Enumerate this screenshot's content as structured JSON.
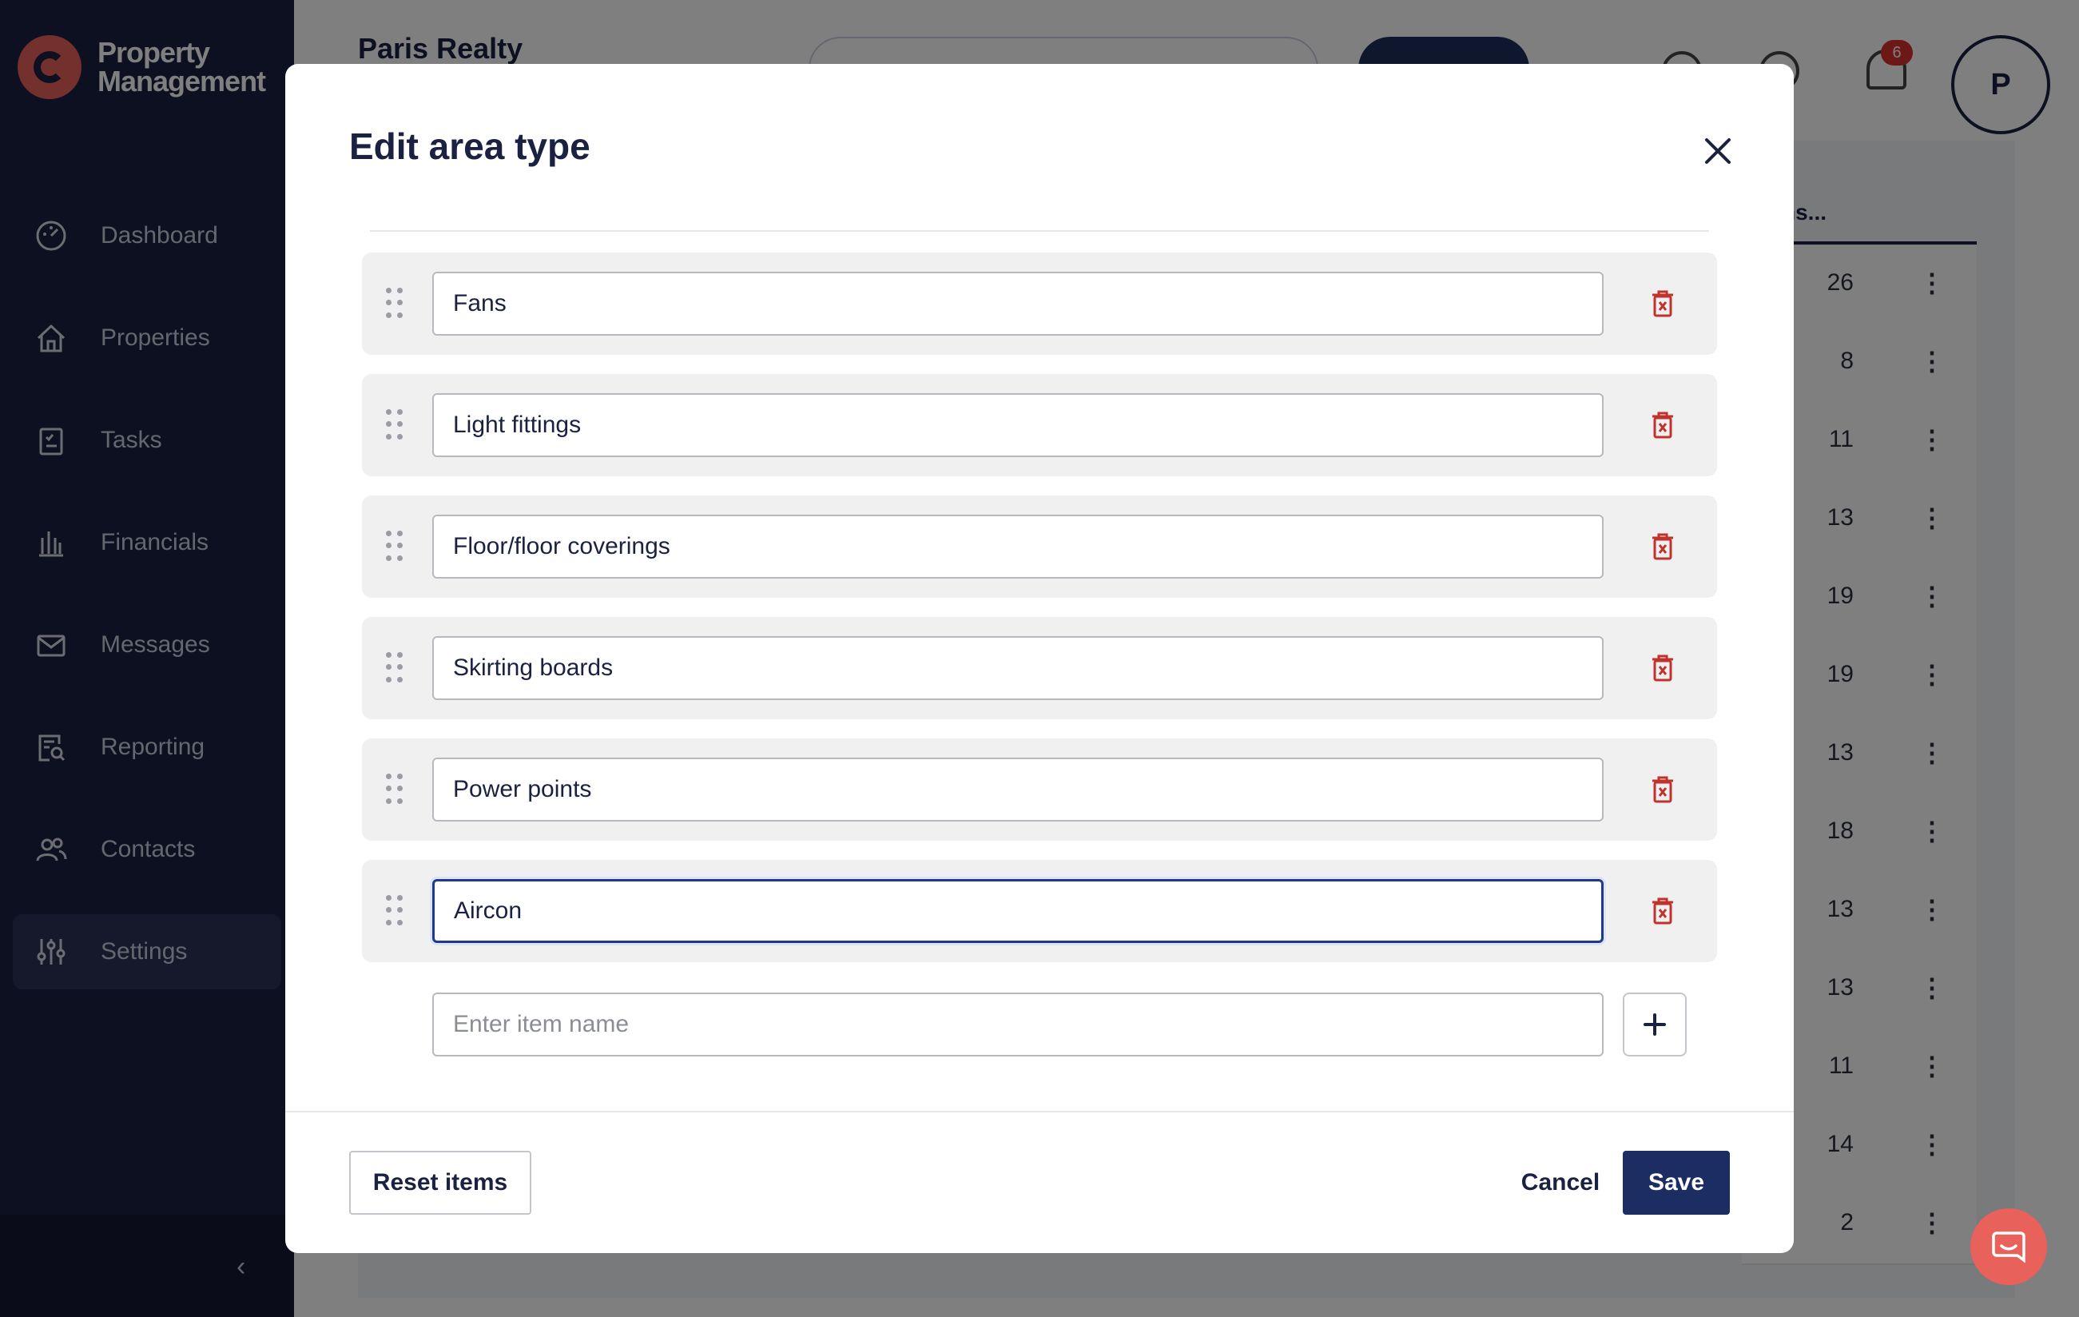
{
  "app": {
    "logo_line1": "Property",
    "logo_line2": "Management",
    "company_name": "Paris Realty",
    "notification_count": "6",
    "avatar_initial": "P"
  },
  "sidebar": {
    "items": [
      {
        "label": "Dashboard",
        "icon": "dashboard-icon"
      },
      {
        "label": "Properties",
        "icon": "home-icon"
      },
      {
        "label": "Tasks",
        "icon": "clipboard-icon"
      },
      {
        "label": "Financials",
        "icon": "bank-icon"
      },
      {
        "label": "Messages",
        "icon": "mail-icon"
      },
      {
        "label": "Reporting",
        "icon": "report-icon"
      },
      {
        "label": "Contacts",
        "icon": "users-icon"
      },
      {
        "label": "Settings",
        "icon": "sliders-icon",
        "active": true
      }
    ]
  },
  "table": {
    "header": "ns...",
    "counts": [
      "26",
      "8",
      "11",
      "13",
      "19",
      "19",
      "13",
      "18",
      "13",
      "13",
      "11",
      "14",
      "2"
    ]
  },
  "modal": {
    "title": "Edit area type",
    "items": [
      {
        "value": "Fans"
      },
      {
        "value": "Light fittings"
      },
      {
        "value": "Floor/floor coverings"
      },
      {
        "value": "Skirting boards"
      },
      {
        "value": "Power points"
      },
      {
        "value": "Aircon",
        "focused": true
      }
    ],
    "new_item_placeholder": "Enter item name",
    "reset_label": "Reset items",
    "cancel_label": "Cancel",
    "save_label": "Save"
  },
  "colors": {
    "primary": "#1b2d63",
    "danger": "#c0322c",
    "sidebar": "#1b2140",
    "accent": "#e8615a"
  }
}
